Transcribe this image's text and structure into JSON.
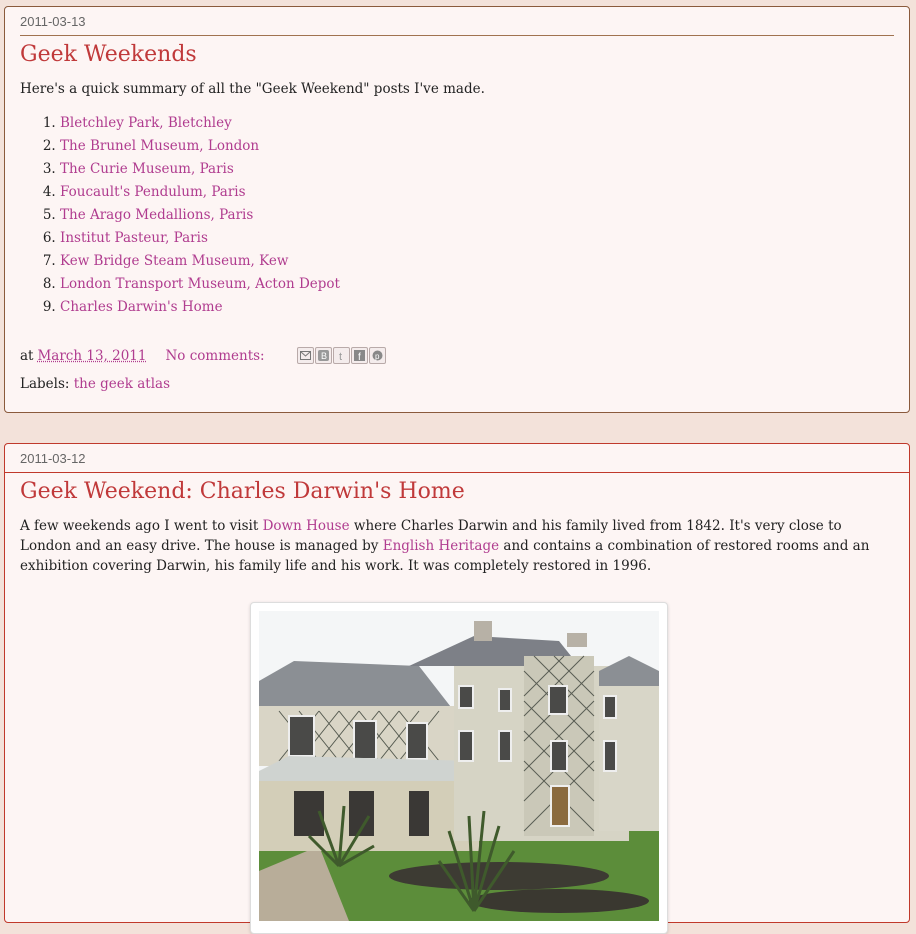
{
  "posts": [
    {
      "date": "2011-03-13",
      "title": "Geek Weekends",
      "intro": "Here's a quick summary of all the \"Geek Weekend\" posts I've made.",
      "items": [
        "Bletchley Park, Bletchley",
        "The Brunel Museum, London",
        "The Curie Museum, Paris",
        "Foucault's Pendulum, Paris",
        "The Arago Medallions, Paris",
        "Institut Pasteur, Paris",
        "Kew Bridge Steam Museum, Kew",
        "London Transport Museum, Acton Depot",
        "Charles Darwin's Home"
      ],
      "footer": {
        "at_label": "at",
        "date_link": "March 13, 2011",
        "comments": "No comments:",
        "labels_prefix": "Labels:",
        "label": "the geek atlas"
      }
    },
    {
      "date": "2011-03-12",
      "title": "Geek Weekend: Charles Darwin's Home",
      "body": {
        "p1": "A few weekends ago I went to visit ",
        "link1": "Down House",
        "p2": " where Charles Darwin and his family lived from 1842. It's very close to London and an easy drive. The house is managed by ",
        "link2": "English Heritage",
        "p3": " and contains a combination of restored rooms and an exhibition covering Darwin, his family life and his work. It was completely restored in 1996."
      }
    }
  ],
  "share_icons": [
    "email-icon",
    "blogger-icon",
    "twitter-icon",
    "facebook-icon",
    "pinterest-icon"
  ],
  "colors": {
    "title": "#c0393a",
    "link": "#b03c8f",
    "background": "#f3e2da",
    "post_bg": "#fdf5f4"
  }
}
